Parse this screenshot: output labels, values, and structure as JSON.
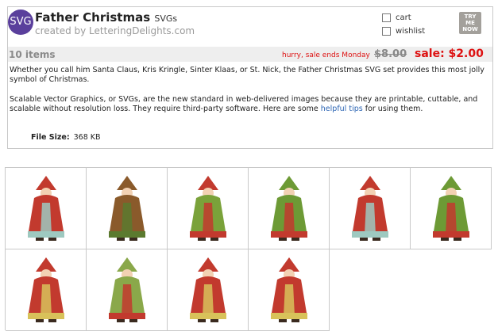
{
  "logo": "SVG",
  "product": {
    "title": "Father Christmas",
    "title_suffix": "SVGs",
    "byline": "created by LetteringDelights.com"
  },
  "actions": {
    "cart_label": "cart",
    "wishlist_label": "wishlist",
    "try_lines": [
      "TRY",
      "ME",
      "NOW"
    ]
  },
  "sale": {
    "count": "10 items",
    "hurry": "hurry, sale ends Monday",
    "old_price": "$8.00",
    "sale_price": "sale: $2.00"
  },
  "description": {
    "p1": "Whether you call him Santa Claus, Kris Kringle, Sinter Klaas, or St. Nick, the Father Christmas SVG set provides this most jolly symbol of Christmas.",
    "p2_before": "Scalable Vector Graphics, or SVGs, are the new standard in web-delivered images because they are printable, cuttable, and scalable without resolution loss. They require third-party software. Here are some",
    "p2_link": "helpful tips",
    "p2_after": "for using them."
  },
  "file_size": {
    "label": "File Size:",
    "value": "368 KB"
  },
  "thumbnails": [
    {
      "robe": "#c23a2e",
      "trim": "#9ec9c0",
      "hat": "#c23a2e"
    },
    {
      "robe": "#8a5a2b",
      "trim": "#5b7a2f",
      "hat": "#8a5a2b"
    },
    {
      "robe": "#7aa23a",
      "trim": "#c23a2e",
      "hat": "#c23a2e"
    },
    {
      "robe": "#6d9a35",
      "trim": "#c23a2e",
      "hat": "#6d9a35"
    },
    {
      "robe": "#c23a2e",
      "trim": "#9ec9c0",
      "hat": "#c23a2e"
    },
    {
      "robe": "#6d9a35",
      "trim": "#c23a2e",
      "hat": "#6d9a35"
    },
    {
      "robe": "#c23a2e",
      "trim": "#d8c25a",
      "hat": "#c23a2e"
    },
    {
      "robe": "#8aa84a",
      "trim": "#c23a2e",
      "hat": "#8aa84a"
    },
    {
      "robe": "#c23a2e",
      "trim": "#d8c25a",
      "hat": "#c23a2e"
    },
    {
      "robe": "#c23a2e",
      "trim": "#d8c25a",
      "hat": "#c23a2e"
    }
  ]
}
